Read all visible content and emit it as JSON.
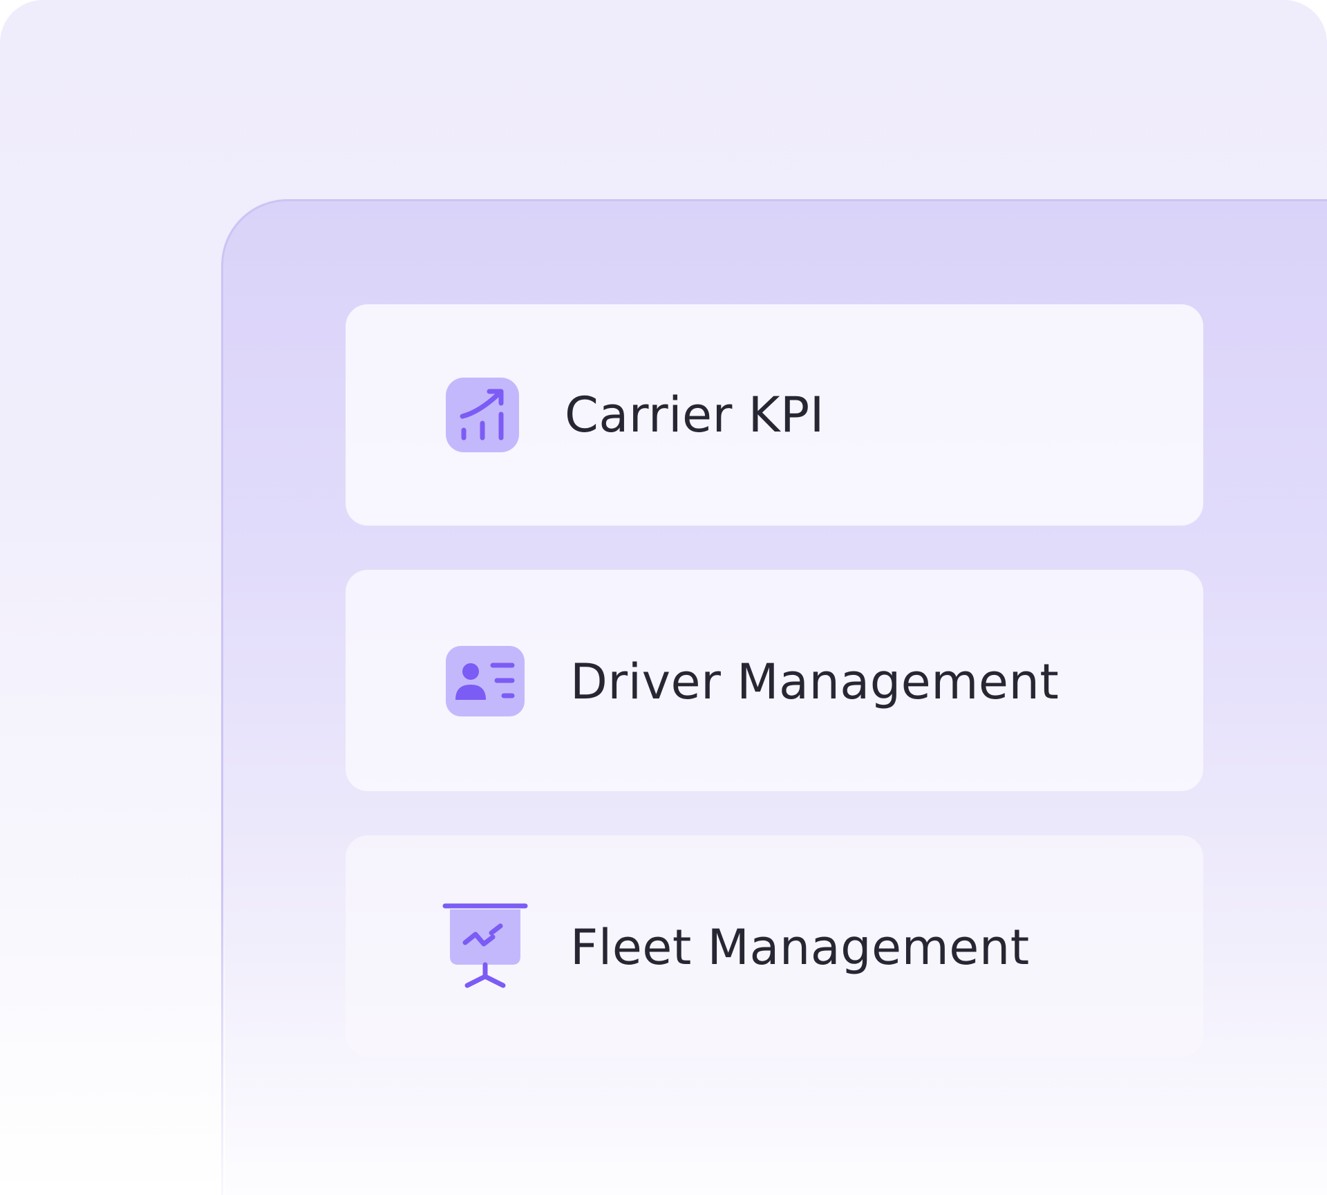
{
  "menu": {
    "items": [
      {
        "label": "Carrier KPI",
        "icon": "chart-trend-up-icon"
      },
      {
        "label": "Driver Management",
        "icon": "id-card-icon"
      },
      {
        "label": "Fleet Management",
        "icon": "presentation-board-icon"
      }
    ]
  },
  "colors": {
    "icon_fill": "#c4b8fc",
    "icon_stroke": "#7b5cf5",
    "text": "#272733",
    "card_bg": "#f8f7fd",
    "panel_bg": "#dcd4fa"
  }
}
